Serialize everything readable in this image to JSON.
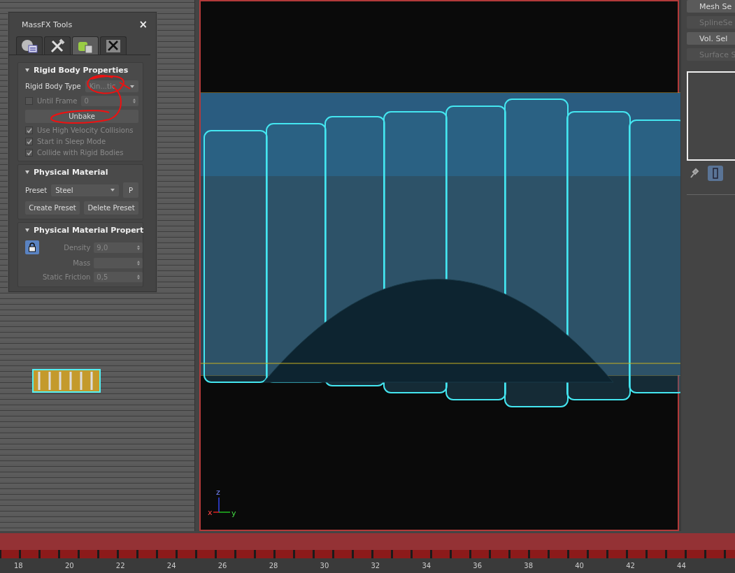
{
  "massfx_panel": {
    "title": "MassFX Tools",
    "close": "×",
    "tabs": [
      {
        "kind": "world",
        "selected": false
      },
      {
        "kind": "tools",
        "selected": false
      },
      {
        "kind": "object",
        "selected": true
      },
      {
        "kind": "utilities",
        "selected": false
      }
    ],
    "rigid_body": {
      "title": "Rigid Body Properties",
      "type_label": "Rigid Body Type",
      "type_value": "Kin...tic",
      "disabled": true,
      "until_frame": {
        "label": "Until Frame",
        "checked": false,
        "value": "0"
      },
      "unbake": "Unbake",
      "options": [
        {
          "label": "Use High Velocity Collisions",
          "checked": true
        },
        {
          "label": "Start in Sleep Mode",
          "checked": true
        },
        {
          "label": "Collide with Rigid Bodies",
          "checked": true
        }
      ]
    },
    "physical_material": {
      "title": "Physical Material",
      "preset_label": "Preset",
      "preset_value": "Steel",
      "p_button": "P",
      "buttons": [
        "Create Preset",
        "Delete Preset"
      ]
    },
    "material_properties": {
      "title": "Physical Material Propert",
      "locked": true,
      "fields": [
        {
          "label": "Density",
          "value": "9,0"
        },
        {
          "label": "Mass"
        },
        {
          "label": "Static Friction",
          "value": "0,5"
        }
      ]
    }
  },
  "viewport": {
    "axis_tripod": {
      "x": "x",
      "y": "y",
      "z": "z"
    }
  },
  "command_panel": {
    "buttons": [
      {
        "label": "Mesh Se",
        "disabled": false
      },
      {
        "label": "SplineSe",
        "disabled": true
      },
      {
        "label": "Vol. Sel",
        "disabled": false
      },
      {
        "label": "Surface S",
        "disabled": true
      }
    ],
    "tools": [
      {
        "kind": "pin",
        "selected": false
      },
      {
        "kind": "slot",
        "selected": true
      }
    ]
  },
  "timeline": {
    "labels": [
      "18",
      "20",
      "22",
      "24",
      "26",
      "28",
      "30",
      "32",
      "34",
      "36",
      "38",
      "40",
      "42",
      "44"
    ]
  }
}
